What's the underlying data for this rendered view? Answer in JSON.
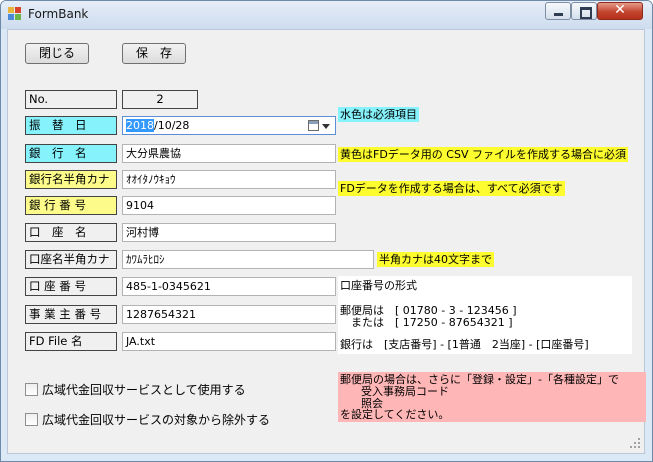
{
  "window": {
    "title": "FormBank"
  },
  "toolbar": {
    "close_label": "閉じる",
    "save_label": "保　存"
  },
  "fields": {
    "no": {
      "label": "No.",
      "value": "2"
    },
    "transfer_date": {
      "label": "振　替　日",
      "value_selected": "2018",
      "value_rest": "/10/28"
    },
    "bank_name": {
      "label": "銀　行　名",
      "value": "大分県農協"
    },
    "bank_kana": {
      "label": "銀行名半角カナ",
      "value": "ｵｵｲﾀﾉｳｷｮｳ"
    },
    "bank_number": {
      "label": "銀 行 番 号",
      "value": "9104"
    },
    "account_name": {
      "label": "口　座　名",
      "value": "河村博"
    },
    "account_kana": {
      "label": "口座名半角カナ",
      "value": "ｶﾜﾑﾗﾋﾛｼ"
    },
    "account_number": {
      "label": "口 座 番 号",
      "value": "485-1-0345621"
    },
    "employer_number": {
      "label": "事 業 主 番 号",
      "value": "1287654321"
    },
    "fd_file": {
      "label": "FD File 名",
      "value": "JA.txt"
    }
  },
  "notes": {
    "cyan_required": "水色は必須項目",
    "yellow_csv": "黄色はFDデータ用の CSV ファイルを作成する場合に必須",
    "fd_required": "FDデータを作成する場合は、すべて必須です",
    "kana_limit": "半角カナは40文字まで"
  },
  "account_format": {
    "heading": "口座番号の形式",
    "line1": "郵便局は　[ 01780 - 3 - 123456 ]",
    "line2": "　または　[ 17250 - 87654321 ]",
    "line3": "銀行は　[支店番号] - [1普通　2当座] - [口座番号]"
  },
  "postal_note": {
    "line1": "郵便局の場合は、さらに「登録・設定」-「各種設定」で",
    "line2": "      受入事務局コード",
    "line3": "      照会",
    "line4": "を設定してください。"
  },
  "checkboxes": {
    "use_wide_area": {
      "label": "広域代金回収サービスとして使用する",
      "checked": false
    },
    "exclude_wide_area": {
      "label": "広域代金回収サービスの対象から除外する",
      "checked": false
    }
  },
  "colors": {
    "required": "#86f2fb",
    "fd_required": "#fdfc8a",
    "note_yellow": "#fdfc2e",
    "pink": "#ffb6b6"
  }
}
